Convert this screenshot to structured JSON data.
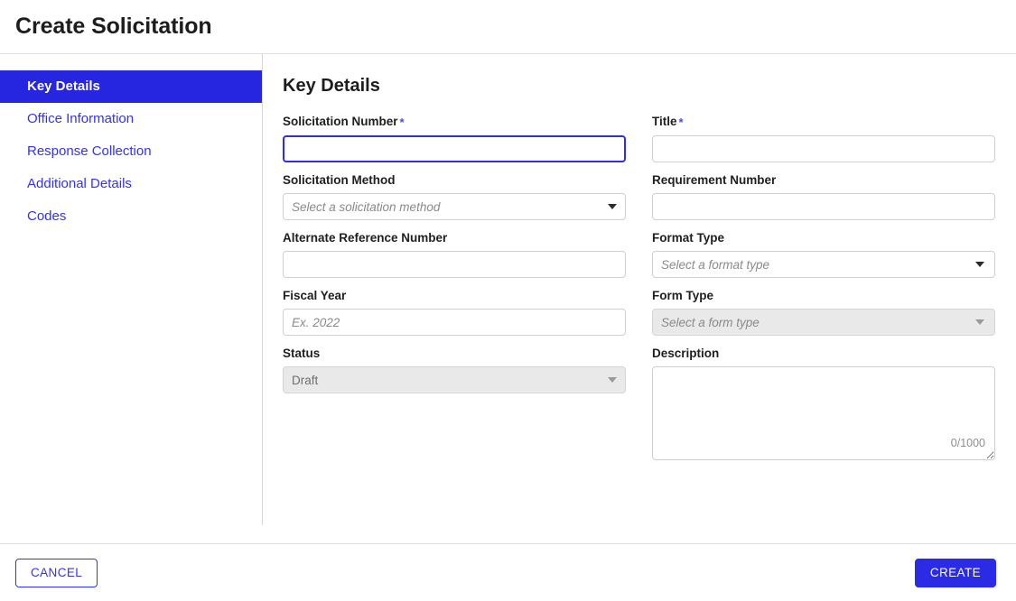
{
  "header": {
    "title": "Create Solicitation"
  },
  "colors": {
    "accent_blue": "#2626e0",
    "link_blue": "#3333ee",
    "required_star": "#4a4ae8",
    "focus_border": "#2f2fdd",
    "disabled_bg": "#e9e9e9"
  },
  "sidebar": {
    "items": [
      {
        "label": "Key Details",
        "active": true
      },
      {
        "label": "Office Information",
        "active": false
      },
      {
        "label": "Response Collection",
        "active": false
      },
      {
        "label": "Additional Details",
        "active": false
      },
      {
        "label": "Codes",
        "active": false
      }
    ]
  },
  "main": {
    "section_title": "Key Details",
    "fields": {
      "solicitation_number": {
        "label": "Solicitation Number",
        "required": true,
        "required_marker": "*",
        "value": "",
        "placeholder": ""
      },
      "title": {
        "label": "Title",
        "required": true,
        "required_marker": "*",
        "value": "",
        "placeholder": ""
      },
      "solicitation_method": {
        "label": "Solicitation Method",
        "required": false,
        "selected": "Select a solicitation method",
        "disabled": false
      },
      "requirement_number": {
        "label": "Requirement Number",
        "required": false,
        "value": "",
        "placeholder": ""
      },
      "alternate_reference_number": {
        "label": "Alternate Reference Number",
        "required": false,
        "value": "",
        "placeholder": ""
      },
      "format_type": {
        "label": "Format Type",
        "required": false,
        "selected": "Select a format type",
        "disabled": false
      },
      "fiscal_year": {
        "label": "Fiscal Year",
        "required": false,
        "value": "",
        "placeholder": "Ex. 2022"
      },
      "form_type": {
        "label": "Form Type",
        "required": false,
        "selected": "Select a form type",
        "disabled": true
      },
      "status": {
        "label": "Status",
        "required": false,
        "selected": "Draft",
        "disabled": true
      },
      "description": {
        "label": "Description",
        "required": false,
        "value": "",
        "placeholder": "",
        "counter": "0/1000"
      }
    }
  },
  "footer": {
    "cancel_label": "CANCEL",
    "create_label": "CREATE"
  }
}
